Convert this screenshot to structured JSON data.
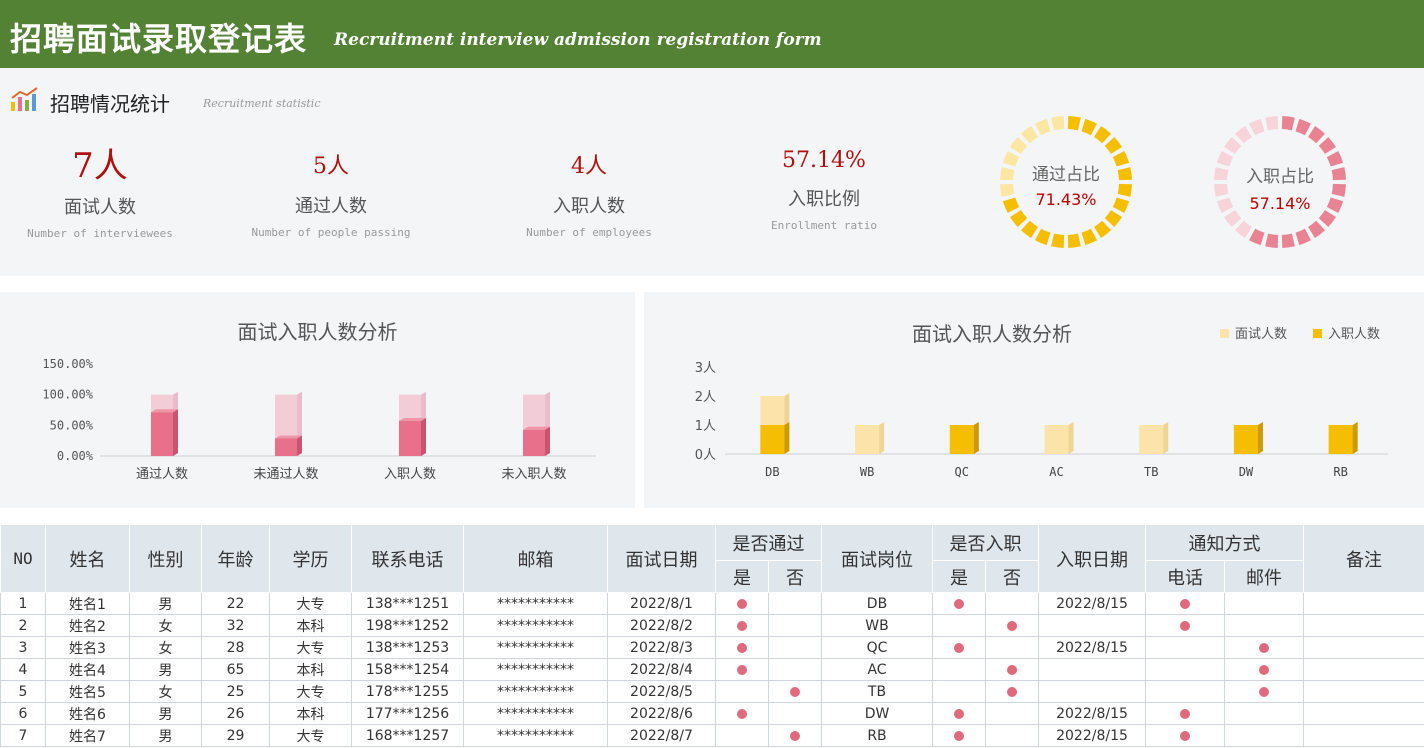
{
  "header": {
    "title": "招聘面试录取登记表",
    "subtitle": "Recruitment interview admission registration form"
  },
  "section": {
    "icon": "bar-chart-icon",
    "title": "招聘情况统计",
    "subtitle": "Recruitment statistic"
  },
  "kpis": [
    {
      "value": "7人",
      "label": "面试人数",
      "en": "Number of interviewees"
    },
    {
      "value": "5人",
      "label": "通过人数",
      "en": "Number of people passing"
    },
    {
      "value": "4人",
      "label": "入职人数",
      "en": "Number of employees"
    },
    {
      "value": "57.14%",
      "label": "入职比例",
      "en": "Enrollment ratio"
    }
  ],
  "rings": [
    {
      "label": "通过占比",
      "value": "71.43%",
      "fraction": 0.7143,
      "color": "#f5bf00",
      "light": "#fbe7a1"
    },
    {
      "label": "入职占比",
      "value": "57.14%",
      "fraction": 0.5714,
      "color": "#e98393",
      "light": "#f7d3da"
    }
  ],
  "colors": {
    "banner": "#548235",
    "accent": "#b01010",
    "pink": "#e8708a",
    "gold": "#f5bf00"
  },
  "chart_data": [
    {
      "type": "bar",
      "title": "面试入职人数分析",
      "categories": [
        "通过人数",
        "未通过人数",
        "入职人数",
        "未入职人数"
      ],
      "series": [
        {
          "values": [
            71.43,
            28.57,
            57.14,
            42.86
          ]
        },
        {
          "values": [
            100,
            100,
            100,
            100
          ]
        }
      ],
      "ylim": [
        0,
        150
      ],
      "yticks": [
        "0.00%",
        "50.00%",
        "100.00%",
        "150.00%"
      ],
      "colors": [
        "#e8708a",
        "#f2cdd7"
      ]
    },
    {
      "type": "bar",
      "title": "面试入职人数分析",
      "categories": [
        "DB",
        "WB",
        "QC",
        "AC",
        "TB",
        "DW",
        "RB"
      ],
      "series": [
        {
          "name": "面试人数",
          "values": [
            2,
            1,
            1,
            1,
            1,
            1,
            1
          ]
        },
        {
          "name": "入职人数",
          "values": [
            1,
            0,
            1,
            0,
            0,
            1,
            1
          ]
        }
      ],
      "ylim": [
        0,
        3
      ],
      "yticks": [
        "0人",
        "1人",
        "2人",
        "3人"
      ],
      "legend": "top-right",
      "colors": [
        "#fbe3aa",
        "#f5bf00"
      ]
    }
  ],
  "table": {
    "headers": {
      "no": "NO",
      "name": "姓名",
      "gender": "性别",
      "age": "年龄",
      "edu": "学历",
      "phone": "联系电话",
      "email": "邮箱",
      "date": "面试日期",
      "passed": "是否通过",
      "yes": "是",
      "no_": "否",
      "position": "面试岗位",
      "hired": "是否入职",
      "hire_date": "入职日期",
      "notify": "通知方式",
      "tel": "电话",
      "mail": "邮件",
      "remark": "备注"
    },
    "rows": [
      {
        "no": "1",
        "name": "姓名1",
        "gender": "男",
        "age": "22",
        "edu": "大专",
        "phone": "138***1251",
        "email": "***********",
        "date": "2022/8/1",
        "pass_yes": true,
        "pass_no": false,
        "position": "DB",
        "hire_yes": true,
        "hire_no": false,
        "hire_date": "2022/8/15",
        "tel": true,
        "mail": false,
        "remark": ""
      },
      {
        "no": "2",
        "name": "姓名2",
        "gender": "女",
        "age": "32",
        "edu": "本科",
        "phone": "198***1252",
        "email": "***********",
        "date": "2022/8/2",
        "pass_yes": true,
        "pass_no": false,
        "position": "WB",
        "hire_yes": false,
        "hire_no": true,
        "hire_date": "",
        "tel": true,
        "mail": false,
        "remark": ""
      },
      {
        "no": "3",
        "name": "姓名3",
        "gender": "女",
        "age": "28",
        "edu": "大专",
        "phone": "138***1253",
        "email": "***********",
        "date": "2022/8/3",
        "pass_yes": true,
        "pass_no": false,
        "position": "QC",
        "hire_yes": true,
        "hire_no": false,
        "hire_date": "2022/8/15",
        "tel": false,
        "mail": true,
        "remark": ""
      },
      {
        "no": "4",
        "name": "姓名4",
        "gender": "男",
        "age": "65",
        "edu": "本科",
        "phone": "158***1254",
        "email": "***********",
        "date": "2022/8/4",
        "pass_yes": true,
        "pass_no": false,
        "position": "AC",
        "hire_yes": false,
        "hire_no": true,
        "hire_date": "",
        "tel": false,
        "mail": true,
        "remark": ""
      },
      {
        "no": "5",
        "name": "姓名5",
        "gender": "女",
        "age": "25",
        "edu": "大专",
        "phone": "178***1255",
        "email": "***********",
        "date": "2022/8/5",
        "pass_yes": false,
        "pass_no": true,
        "position": "TB",
        "hire_yes": false,
        "hire_no": true,
        "hire_date": "",
        "tel": false,
        "mail": true,
        "remark": ""
      },
      {
        "no": "6",
        "name": "姓名6",
        "gender": "男",
        "age": "26",
        "edu": "本科",
        "phone": "177***1256",
        "email": "***********",
        "date": "2022/8/6",
        "pass_yes": true,
        "pass_no": false,
        "position": "DW",
        "hire_yes": true,
        "hire_no": false,
        "hire_date": "2022/8/15",
        "tel": true,
        "mail": false,
        "remark": ""
      },
      {
        "no": "7",
        "name": "姓名7",
        "gender": "男",
        "age": "29",
        "edu": "大专",
        "phone": "168***1257",
        "email": "***********",
        "date": "2022/8/7",
        "pass_yes": false,
        "pass_no": true,
        "position": "RB",
        "hire_yes": true,
        "hire_no": false,
        "hire_date": "2022/8/15",
        "tel": true,
        "mail": false,
        "remark": ""
      }
    ]
  }
}
